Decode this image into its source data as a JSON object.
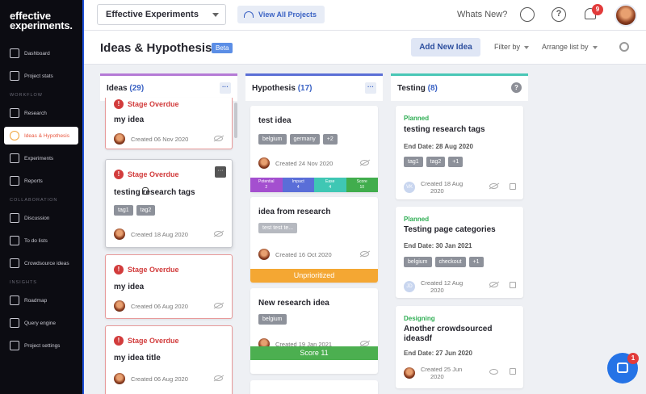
{
  "brand": {
    "line1": "effective",
    "line2": "experiments."
  },
  "sidebar": {
    "items": [
      {
        "label": "Dashboard",
        "icon": "dashboard-icon"
      },
      {
        "label": "Project stats",
        "icon": "stats-icon"
      }
    ],
    "section_workflow": "WORKFLOW",
    "workflow_items": [
      {
        "label": "Research",
        "icon": "research-icon"
      },
      {
        "label": "Ideas & Hypothesis",
        "icon": "lightbulb-icon",
        "active": true
      },
      {
        "label": "Experiments",
        "icon": "experiments-icon"
      },
      {
        "label": "Reports",
        "icon": "reports-icon"
      }
    ],
    "section_collab": "COLLABORATION",
    "collab_items": [
      {
        "label": "Discussion",
        "icon": "discussion-icon"
      },
      {
        "label": "To do lists",
        "icon": "todo-icon"
      },
      {
        "label": "Crowdsource ideas",
        "icon": "crowdsource-icon"
      }
    ],
    "section_insights": "INSIGHTS",
    "insights_items": [
      {
        "label": "Roadmap",
        "icon": "roadmap-icon"
      },
      {
        "label": "Query engine",
        "icon": "query-icon"
      },
      {
        "label": "Project settings",
        "icon": "settings-icon"
      }
    ]
  },
  "topbar": {
    "experiment_select": "Effective Experiments",
    "view_all": "View All Projects",
    "whats_new": "Whats New?",
    "notification_count": "9"
  },
  "header": {
    "title": "Ideas & Hypothesis",
    "badge": "Beta",
    "add_button": "Add New Idea",
    "filter": "Filter by",
    "arrange": "Arrange list by"
  },
  "columns": {
    "ideas": {
      "title": "Ideas",
      "count": "(29)",
      "action": "···",
      "color": "#b57ad6"
    },
    "hypothesis": {
      "title": "Hypothesis",
      "count": "(17)",
      "action": "···",
      "color": "#5b6fd6"
    },
    "testing": {
      "title": "Testing",
      "count": "(8)",
      "action": "?",
      "color": "#49c7b6"
    }
  },
  "ideas_cards": [
    {
      "overdue": "Stage Overdue",
      "title": "my idea",
      "created": "Created 06 Nov 2020"
    },
    {
      "overdue": "Stage Overdue",
      "title": "testing research tags",
      "tags": [
        "tag1",
        "tag2"
      ],
      "created": "Created 18 Aug 2020",
      "menu": "···"
    },
    {
      "overdue": "Stage Overdue",
      "title": "my idea",
      "created": "Created 06 Aug 2020"
    },
    {
      "overdue": "Stage Overdue",
      "title": "my idea title",
      "created": "Created 06 Aug 2020"
    }
  ],
  "hypothesis_cards": [
    {
      "title": "test idea",
      "tags": [
        "belgium",
        "germany",
        "+2"
      ],
      "created": "Created 24 Nov 2020",
      "scores": [
        {
          "label": "Potential",
          "value": "2"
        },
        {
          "label": "Impact",
          "value": "4"
        },
        {
          "label": "Ease",
          "value": "4"
        },
        {
          "label": "Score",
          "value": "10"
        }
      ]
    },
    {
      "title": "idea from research",
      "tags": [
        "test test te..."
      ],
      "created": "Created 16 Oct 2020",
      "bar": "Unprioritized"
    },
    {
      "title": "New research idea",
      "tags": [
        "belgium"
      ],
      "created": "Created 19 Jan 2021",
      "bar": "Score 11"
    }
  ],
  "testing_cards": [
    {
      "status": "Planned",
      "title": "testing research tags",
      "end": "End Date: 28 Aug 2020",
      "tags": [
        "tag1",
        "tag2",
        "+1"
      ],
      "created_line1": "Created 18 Aug",
      "created_line2": "2020",
      "initials": "VK"
    },
    {
      "status": "Planned",
      "title": "Testing page categories",
      "end": "End Date: 30 Jan 2021",
      "tags": [
        "belgium",
        "checkout",
        "+1"
      ],
      "created_line1": "Created 12 Aug",
      "created_line2": "2020",
      "initials": "JD"
    },
    {
      "status": "Designing",
      "title_line1": "Another crowdsourced",
      "title_line2": "ideasdf",
      "end": "End Date: 27 Jun 2020",
      "created_line1": "Created 25 Jun",
      "created_line2": "2020"
    }
  ],
  "chat_badge": "1",
  "colors": {
    "accent": "#3a62c4",
    "overdue": "#d23c3c",
    "planned": "#2fae54",
    "unprioritized": "#f4a733",
    "score": "#4caf50"
  }
}
